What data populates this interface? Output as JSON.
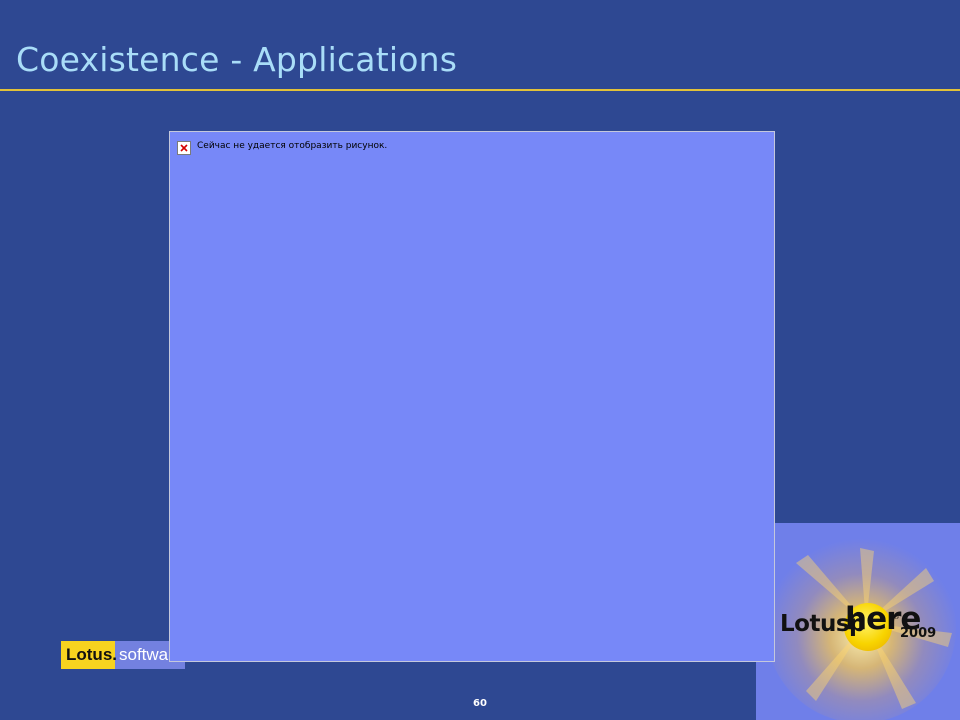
{
  "slide": {
    "title": "Coexistence - Applications",
    "page_number": "60"
  },
  "image_placeholder": {
    "icon": "broken-image-icon",
    "message": "Сейчас не удается отобразить рисунок."
  },
  "footer_logo": {
    "brand": "Lotus.",
    "product": "software"
  },
  "event_logo": {
    "text_prefix": "Lotusp",
    "text_highlight": "here",
    "registered_mark": "®",
    "year": "2009"
  },
  "colors": {
    "background": "#2e4892",
    "title": "#a9ddf8",
    "title_rule": "#e2c23a",
    "image_frame": "#7788f8",
    "logo_panel": "#6f7fe9",
    "lotus_yellow": "#f7d31f"
  }
}
